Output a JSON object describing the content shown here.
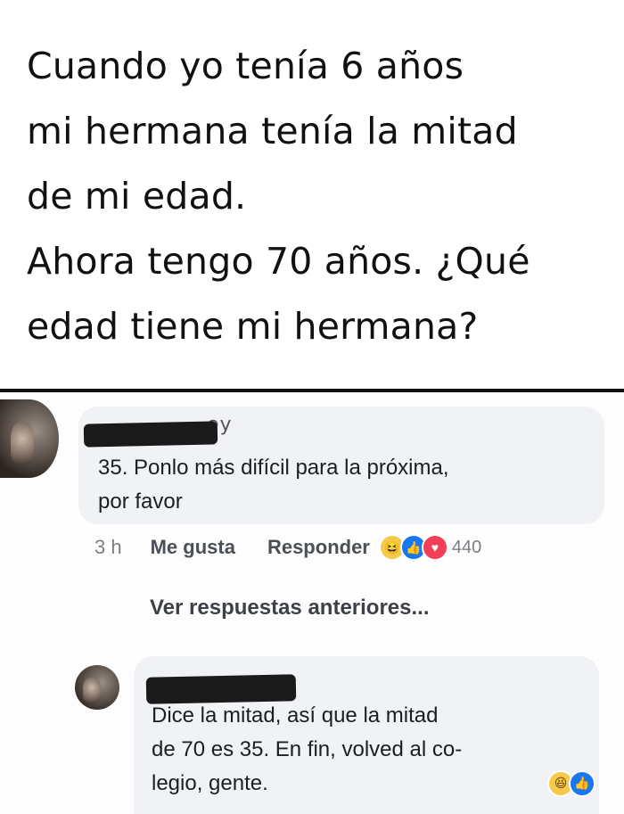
{
  "question": {
    "lines": [
      "Cuando yo tenía 6 años",
      "mi hermana tenía la mitad",
      "de mi edad.",
      "Ahora tengo 70 años. ¿Qué",
      "edad tiene mi hermana?"
    ]
  },
  "comment_1": {
    "author_partial": "ey",
    "lines": [
      "35. Ponlo más difícil para la próxima,",
      "por favor"
    ],
    "time": "3 h",
    "like_label": "Me gusta",
    "reply_label": "Responder",
    "reaction_icons": [
      "haha-reaction-icon",
      "like-reaction-icon",
      "love-reaction-icon"
    ],
    "reaction_count": "440"
  },
  "view_previous_replies": "Ver respuestas anteriores...",
  "reply_1": {
    "lines": [
      "Dice la mitad, así que la mitad",
      "de 70 es 35. En fin, volved al co-",
      "legio, gente."
    ],
    "reaction_icons": [
      "haha-reaction-icon",
      "like-reaction-icon"
    ]
  },
  "colors": {
    "bubble": "#f0f2f5",
    "like_blue": "#1877f2",
    "love_red": "#f33e58",
    "haha_yellow": "#f7c94b"
  }
}
